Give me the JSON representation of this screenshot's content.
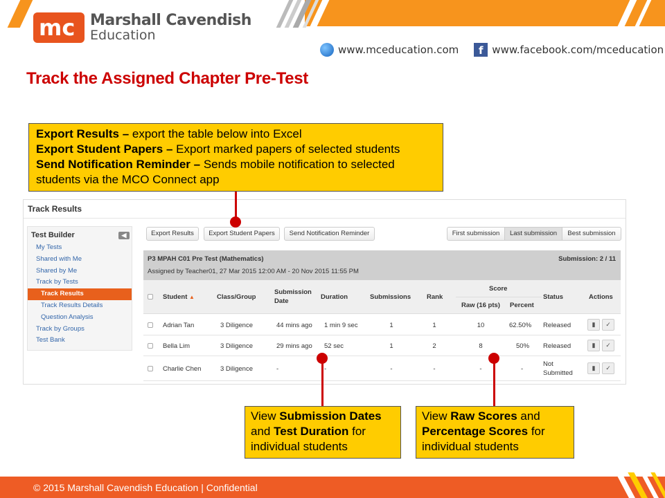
{
  "brand": {
    "logo_mark": "mc",
    "name_line1": "Marshall Cavendish",
    "name_line2": "Education",
    "accent": "#e8541e",
    "stripe_color": "#f7941d"
  },
  "links": {
    "website": "www.mceducation.com",
    "facebook": "www.facebook.com/mceducation",
    "website_icon": "globe-icon",
    "facebook_icon": "facebook-icon"
  },
  "slide": {
    "title": "Track the Assigned Chapter Pre-Test",
    "title_color": "#cc0000"
  },
  "callouts": {
    "top": [
      {
        "bold": "Export Results –",
        "text": " export the table below into Excel"
      },
      {
        "bold": "Export Student Papers –",
        "text": " Export marked papers of selected students"
      },
      {
        "bold": "Send Notification Reminder –",
        "text": " Sends mobile notification to selected students via the MCO Connect app"
      }
    ],
    "dates": {
      "p1": "View ",
      "b1": "Submission Dates",
      "p2": " and ",
      "b2": "Test Duration",
      "p3": " for individual students"
    },
    "raw": {
      "p1": "View ",
      "b1": "Raw Scores",
      "p2": " and ",
      "b2": "Percentage Scores",
      "p3": " for individual students"
    },
    "color": "#ffcc00"
  },
  "app": {
    "title": "Track Results",
    "sidebar": {
      "heading": "Test Builder",
      "collapse_icon": "chevron-left-icon",
      "items": [
        {
          "label": "My Tests",
          "sub": false,
          "active": false
        },
        {
          "label": "Shared with Me",
          "sub": false,
          "active": false
        },
        {
          "label": "Shared by Me",
          "sub": false,
          "active": false
        },
        {
          "label": "Track by Tests",
          "sub": false,
          "active": false
        },
        {
          "label": "Track Results",
          "sub": true,
          "active": true
        },
        {
          "label": "Track Results Details",
          "sub": true,
          "active": false
        },
        {
          "label": "Question Analysis",
          "sub": true,
          "active": false
        },
        {
          "label": "Track by Groups",
          "sub": false,
          "active": false
        },
        {
          "label": "Test Bank",
          "sub": false,
          "active": false
        }
      ]
    },
    "toolbar": {
      "export_results": "Export Results",
      "export_papers": "Export Student Papers",
      "send_reminder": "Send Notification Reminder",
      "first_submission": "First submission",
      "last_submission": "Last submission",
      "best_submission": "Best submission",
      "selected_view": "Last submission"
    },
    "test": {
      "name": "P3 MPAH C01 Pre Test (Mathematics)",
      "meta": "Assigned by Teacher01, 27 Mar 2015 12:00 AM - 20 Nov 2015 11:55 PM",
      "submission_label": "Submission: 2 / 11"
    },
    "columns": {
      "student": "Student",
      "sort_icon": "sort-asc-icon",
      "class_group": "Class/Group",
      "submission_date_1": "Submission",
      "submission_date_2": "Date",
      "duration": "Duration",
      "submissions": "Submissions",
      "rank": "Rank",
      "score": "Score",
      "raw": "Raw (16 pts)",
      "percent": "Percent",
      "status": "Status",
      "actions": "Actions"
    },
    "rows": [
      {
        "student": "Adrian Tan",
        "class": "3 Diligence",
        "date": "44 mins ago",
        "duration": "1 min 9 sec",
        "submissions": "1",
        "rank": "1",
        "raw": "10",
        "percent": "62.50%",
        "status": "Released",
        "status2": ""
      },
      {
        "student": "Bella Lim",
        "class": "3 Diligence",
        "date": "29 mins ago",
        "duration": "52 sec",
        "submissions": "1",
        "rank": "2",
        "raw": "8",
        "percent": "50%",
        "status": "Released",
        "status2": ""
      },
      {
        "student": "Charlie Chen",
        "class": "3 Diligence",
        "date": "-",
        "duration": "-",
        "submissions": "-",
        "rank": "-",
        "raw": "-",
        "percent": "-",
        "status": "Not",
        "status2": "Submitted"
      }
    ],
    "row_action_icons": [
      "document-icon",
      "edit-check-icon"
    ],
    "active_color": "#e8601c"
  },
  "footer": {
    "text": "© 2015 Marshall Cavendish Education | Confidential",
    "color": "#ee5c25"
  }
}
